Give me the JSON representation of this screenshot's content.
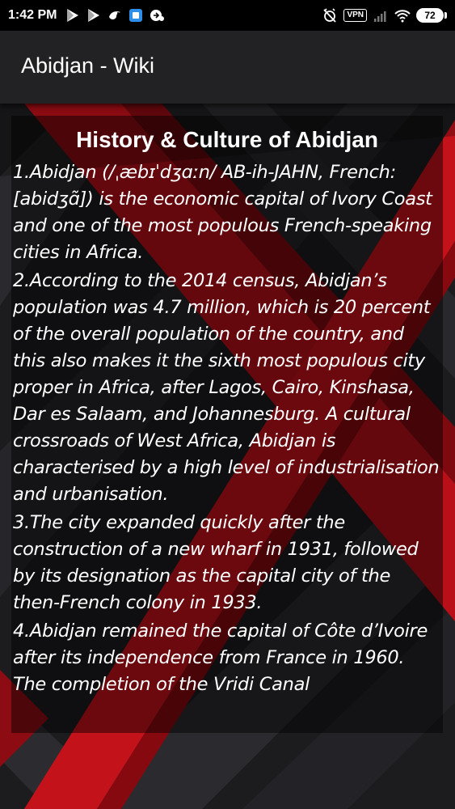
{
  "status_bar": {
    "time": "1:42 PM",
    "vpn": "VPN",
    "battery": "72"
  },
  "app_bar": {
    "title": "Abidjan - Wiki"
  },
  "article": {
    "title": "History & Culture of Abidjan",
    "paragraphs": [
      "1.Abidjan (/ˌæbɪˈdʒɑːn/ AB-ih-JAHN, French: [abidʒɑ̃]) is the economic capital of Ivory Coast and one of the most populous French-speaking cities in Africa.",
      "2.According to the 2014 census, Abidjan’s population was 4.7 million, which is 20 percent of the overall population of the country, and this also makes it the sixth most populous city proper in Africa, after Lagos, Cairo, Kinshasa, Dar es Salaam, and Johannesburg. A cultural crossroads of West Africa, Abidjan is characterised by a high level of industrialisation and urbanisation.",
      "3.The city expanded quickly after the construction of a new wharf in 1931, followed by its designation as the capital city of the then-French colony in 1933.",
      "4.Abidjan remained the capital of Côte d’Ivoire after its independence from France in 1960. The completion of the Vridi Canal"
    ]
  },
  "colors": {
    "accent_red": "#c0111a",
    "panel": "#000000",
    "app_bar": "#222224"
  }
}
